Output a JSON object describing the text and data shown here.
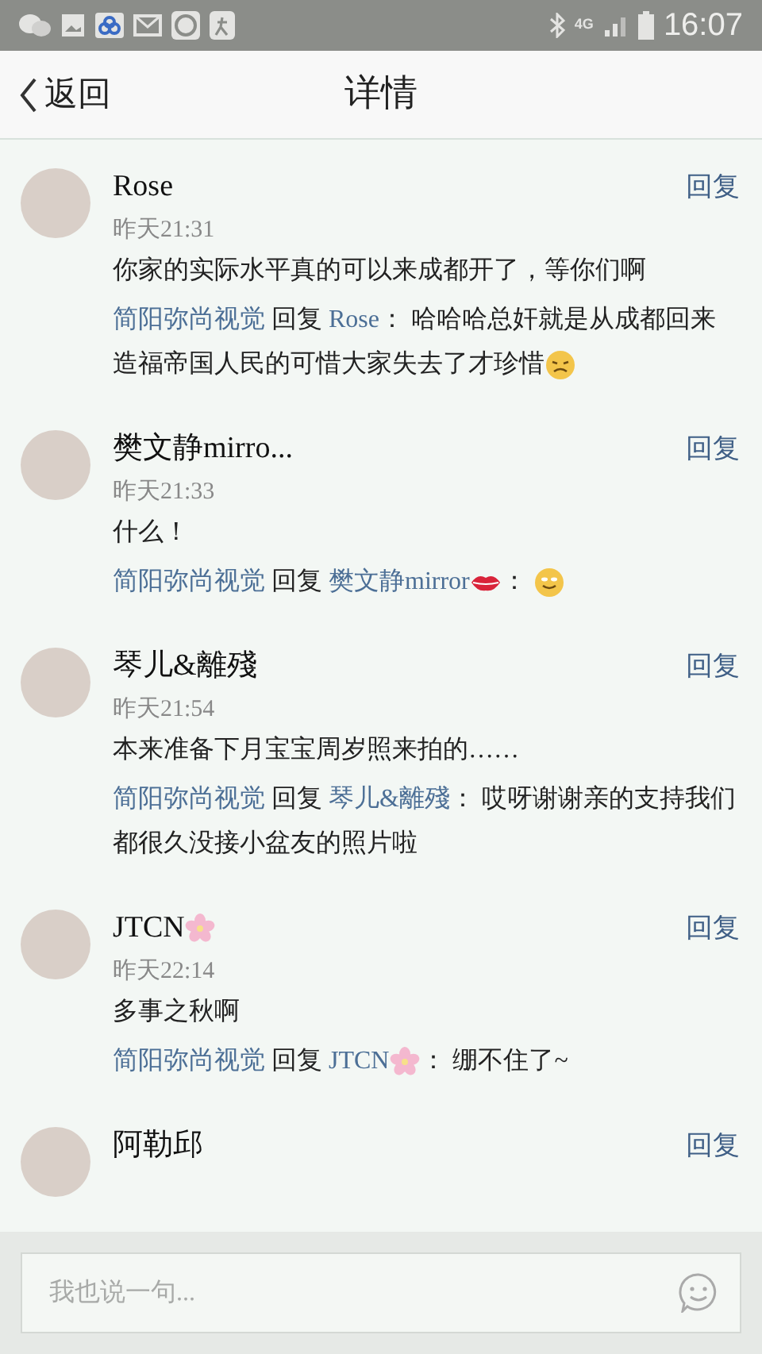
{
  "status_bar": {
    "time": "16:07",
    "network": "4G"
  },
  "header": {
    "back": "返回",
    "title": "详情"
  },
  "comments": [
    {
      "name": "Rose",
      "time": "昨天21:31",
      "reply_button": "回复",
      "text": "你家的实际水平真的可以来成都开了，等你们啊",
      "replies": [
        [
          {
            "kind": "link",
            "text": "简阳弥尚视觉"
          },
          {
            "kind": "text",
            "text": " 回复 "
          },
          {
            "kind": "link",
            "text": "Rose"
          },
          {
            "kind": "text",
            "text": "： 哈哈哈总奸就是从成都回来造福帝国人民的可惜大家失去了才珍惜"
          },
          {
            "kind": "sad"
          }
        ]
      ]
    },
    {
      "name": "樊文静mirro...",
      "time": "昨天21:33",
      "reply_button": "回复",
      "text": "什么！",
      "replies": [
        [
          {
            "kind": "link",
            "text": "简阳弥尚视觉"
          },
          {
            "kind": "text",
            "text": " 回复 "
          },
          {
            "kind": "link",
            "text": "樊文静mirror"
          },
          {
            "kind": "lips"
          },
          {
            "kind": "text",
            "text": "： "
          },
          {
            "kind": "smile"
          }
        ]
      ]
    },
    {
      "name": "琴儿&離殘",
      "time": "昨天21:54",
      "reply_button": "回复",
      "text": "本来准备下月宝宝周岁照来拍的……",
      "replies": [
        [
          {
            "kind": "link",
            "text": "简阳弥尚视觉"
          },
          {
            "kind": "text",
            "text": " 回复 "
          },
          {
            "kind": "link",
            "text": "琴儿&離殘"
          },
          {
            "kind": "text",
            "text": "： 哎呀谢谢亲的支持我们都很久没接小盆友的照片啦"
          }
        ]
      ]
    },
    {
      "name": "JTCN",
      "name_suffix": [
        {
          "kind": "flower"
        }
      ],
      "time": "昨天22:14",
      "reply_button": "回复",
      "text": "多事之秋啊",
      "replies": [
        [
          {
            "kind": "link",
            "text": "简阳弥尚视觉"
          },
          {
            "kind": "text",
            "text": " 回复 "
          },
          {
            "kind": "link",
            "text": "JTCN"
          },
          {
            "kind": "flower"
          },
          {
            "kind": "text",
            "text": "： 绷不住了~"
          }
        ]
      ]
    },
    {
      "name": "阿勒邱",
      "reply_button": "回复"
    }
  ],
  "composer": {
    "placeholder": "我也说一句..."
  }
}
